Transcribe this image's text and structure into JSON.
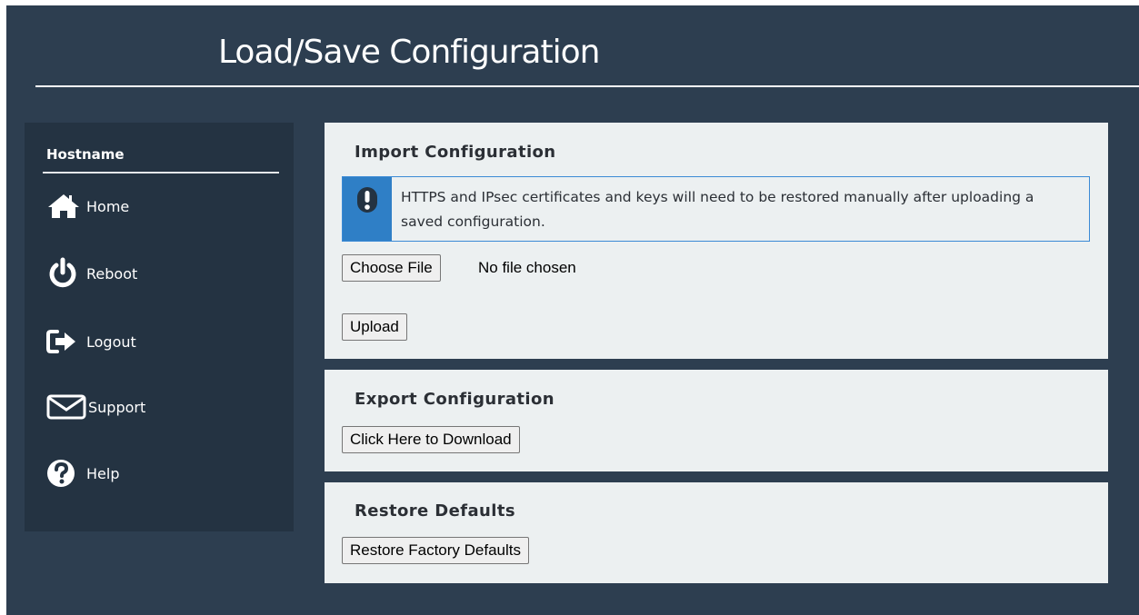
{
  "page": {
    "title": "Load/Save Configuration"
  },
  "sidebar": {
    "hostname_label": "Hostname",
    "items": [
      {
        "label": "Home",
        "icon": "home-icon"
      },
      {
        "label": "Reboot",
        "icon": "power-icon"
      },
      {
        "label": "Logout",
        "icon": "logout-icon"
      },
      {
        "label": "Support",
        "icon": "envelope-icon"
      },
      {
        "label": "Help",
        "icon": "question-circle-icon"
      }
    ]
  },
  "import": {
    "heading": "Import Configuration",
    "notice_icon": "exclamation-icon",
    "notice_text": "HTTPS and IPsec certificates and keys will need to be restored manually after uploading a saved configuration.",
    "choose_file_label": "Choose File",
    "file_status": "No file chosen",
    "upload_label": "Upload"
  },
  "export": {
    "heading": "Export Configuration",
    "download_label": "Click Here to Download"
  },
  "restore": {
    "heading": "Restore Defaults",
    "restore_label": "Restore Factory Defaults"
  },
  "colors": {
    "background": "#2d3e50",
    "sidebar": "#243342",
    "card": "#ecf0f1",
    "notice_accent": "#2f7fc6"
  }
}
